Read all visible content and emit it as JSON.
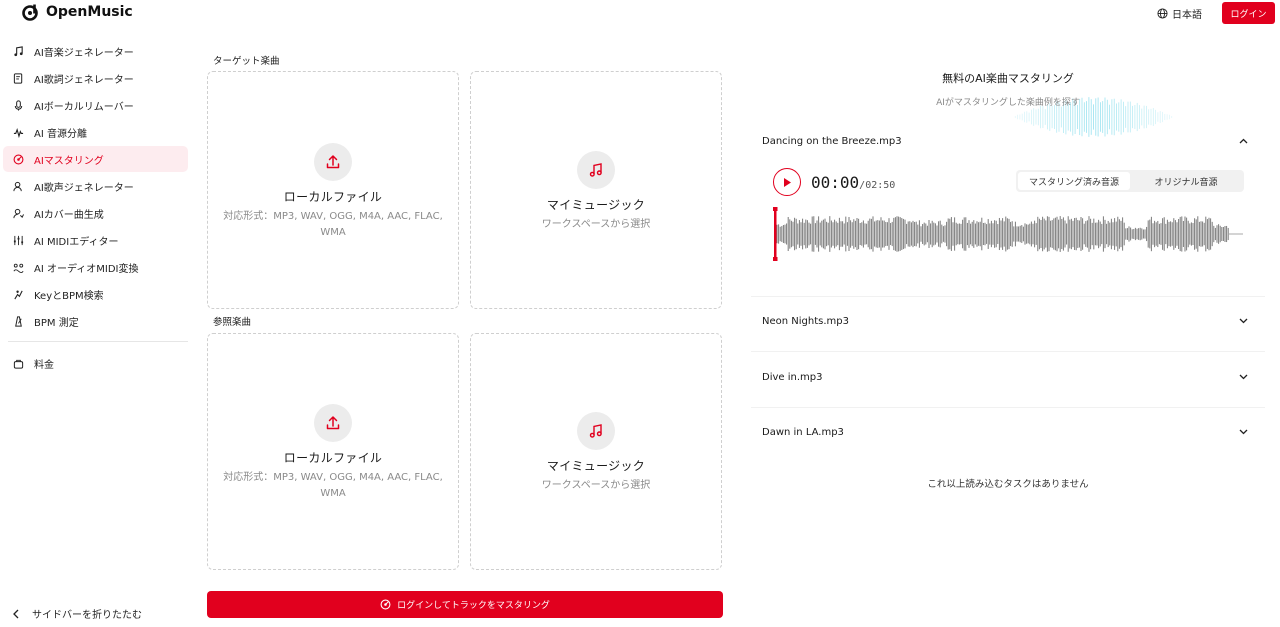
{
  "header": {
    "app_name": "OpenMusic",
    "language": "日本語",
    "login": "ログイン"
  },
  "sidebar": {
    "items": [
      {
        "label": "AI音楽ジェネレーター",
        "icon": "music-note-icon"
      },
      {
        "label": "AI歌詞ジェネレーター",
        "icon": "lyrics-icon"
      },
      {
        "label": "AIボーカルリムーバー",
        "icon": "microphone-icon"
      },
      {
        "label": "AI 音源分離",
        "icon": "waveform-icon"
      },
      {
        "label": "AIマスタリング",
        "icon": "mastering-icon",
        "active": true
      },
      {
        "label": "AI歌声ジェネレーター",
        "icon": "singer-icon"
      },
      {
        "label": "AIカバー曲生成",
        "icon": "cover-icon"
      },
      {
        "label": "AI MIDIエディター",
        "icon": "sliders-icon"
      },
      {
        "label": "AI オーディオMIDI変換",
        "icon": "convert-icon"
      },
      {
        "label": "KeyとBPM検索",
        "icon": "key-icon"
      },
      {
        "label": "BPM 測定",
        "icon": "metronome-icon"
      },
      {
        "label": "料金",
        "icon": "pricing-icon"
      }
    ],
    "collapse": "サイドバーを折りたたむ"
  },
  "upload": {
    "target_label": "ターゲット楽曲",
    "reference_label": "参照楽曲",
    "local": {
      "title": "ローカルファイル",
      "formats": "対応形式：MP3, WAV, OGG, M4A, AAC, FLAC, WMA"
    },
    "library": {
      "title": "マイミュージック",
      "sub": "ワークスペースから選択"
    },
    "master_button": "ログインしてトラックをマスタリング"
  },
  "examples": {
    "title": "無料のAI楽曲マスタリング",
    "subtitle": "AIがマスタリングした楽曲例を探す",
    "tracks": [
      {
        "name": "Dancing on the Breeze.mp3",
        "expanded": true
      },
      {
        "name": "Neon Nights.mp3",
        "expanded": false
      },
      {
        "name": "Dive in.mp3",
        "expanded": false
      },
      {
        "name": "Dawn in LA.mp3",
        "expanded": false
      }
    ],
    "player": {
      "current": "00:00",
      "total": "/02:50",
      "progress": 0,
      "tab_mastered": "マスタリング済み音源",
      "tab_original": "オリジナル音源",
      "selected_tab": "mastered"
    },
    "no_more": "これ以上読み込むタスクはありません"
  },
  "colors": {
    "accent": "#e1001e",
    "active_bg": "#fdecef"
  }
}
